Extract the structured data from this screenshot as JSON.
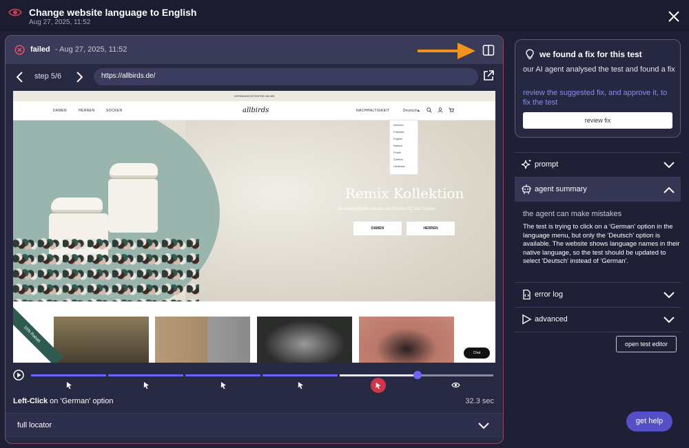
{
  "header": {
    "title": "Change website language to English",
    "date": "Aug 27, 2025, 11:52"
  },
  "status": {
    "label": "failed",
    "date": "- Aug 27, 2025, 11:52"
  },
  "nav": {
    "step": "step 5/6",
    "url": "https://allbirds.de/"
  },
  "website": {
    "promo": "VERSANDKOSTENFREI AB 80€",
    "nav_left": [
      "DAMEN",
      "HERREN",
      "SOCKEN"
    ],
    "logo": "allbirds",
    "nav_right": "NACHHALTIGKEIT",
    "language_selected": "Deutsch",
    "language_options": [
      "Deutsch",
      "Français",
      "English",
      "Italiano",
      "Polski",
      "Čeština",
      "Ukrainian"
    ],
    "hero_title": "Remix Kollektion",
    "hero_subtitle": "Die nachhaltigste Version des Runner NZ und Cruiser",
    "hero_buttons": [
      "DAMEN",
      "HERREN"
    ],
    "ribbon": "10% Rabatt",
    "chat": "Chat"
  },
  "timeline": {
    "progress": 0.838,
    "steps": 6,
    "active_step": 5
  },
  "action": {
    "verb": "Left-Click",
    "target": " on 'German' option",
    "duration": "32.3 sec"
  },
  "locator": {
    "label": "full locator"
  },
  "fix": {
    "title": "we found a fix for this test",
    "description": "our AI agent analysed the test and found a fix",
    "link": "review the suggested fix, and approve it, to fix the test",
    "button": "review fix"
  },
  "sections": {
    "prompt": "prompt",
    "agent_summary": "agent summary",
    "error_log": "error log",
    "advanced": "advanced"
  },
  "summary": {
    "disclaimer": "the agent can make mistakes",
    "text": "The test is trying to click on a 'German' option in the language menu, but only the 'Deutsch' option is available. The website shows language names in their native language, so the test should be updated to select 'Deutsch' instead of 'German'."
  },
  "buttons": {
    "open_editor": "open test editor",
    "get_help": "get help"
  },
  "colors": {
    "accent": "#6c63ff",
    "failed": "#d2344c",
    "arrow": "#f5921e",
    "link": "#8f8cf0"
  }
}
